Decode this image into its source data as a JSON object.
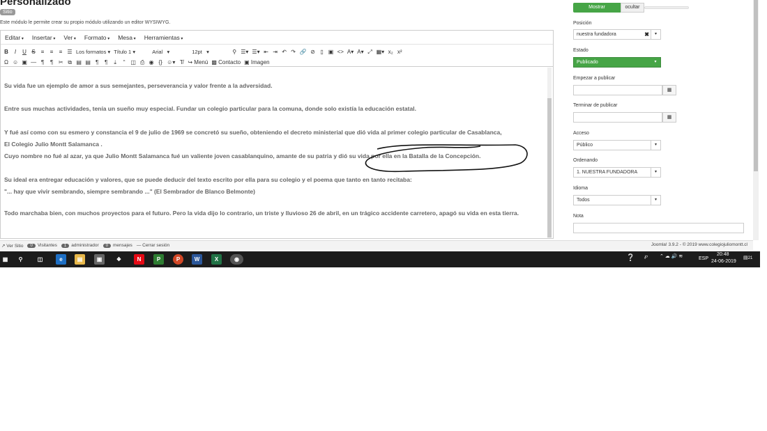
{
  "header": {
    "title": "Personalizado",
    "badge": "Sitio",
    "description": "Este módulo le permite crear su propio módulo utilizando un editor WYSIWYG."
  },
  "editor": {
    "menu": [
      "Editar",
      "Insertar",
      "Ver",
      "Formato",
      "Mesa",
      "Herramientas"
    ],
    "toolbar": {
      "formats_label": "Los formatos",
      "heading_value": "Título 1",
      "font_value": "Arial",
      "size_value": "12pt",
      "menu_button": "Menú",
      "contact_button": "Contacto",
      "image_button": "Imagen"
    },
    "paragraphs": [
      "Su vida fue un ejemplo de amor a sus semejantes, perseverancia y valor frente a la adversidad.",
      "Entre sus muchas actividades, tenía un sueño muy especial. Fundar  un colegio particular para la comuna, donde solo existía la educación estatal.",
      "Y fué así como con su esmero y constancia el  9 de julio de 1969 se concretó su sueño, obteniendo el decreto ministerial que dió vida al primer colegio particular de Casablanca,",
      "El Colegio Julio Montt Salamanca .",
      "Cuyo nombre no fué al azar, ya que  Julio Montt Salamanca  fué un valiente joven casablanquino, amante de su patria y dió su vida por ella  en la Batalla de la Concepción.",
      "Su ideal era entregar educación y valores, que se puede deducir del texto escrito por ella para su colegio y el poema que tanto en tanto recitaba:",
      "\"... hay que vivir sembrando, siempre sembrando ...\" (El Sembrador de Blanco Belmonte)",
      "Todo marchaba bien, con muchos proyectos para el futuro. Pero la vida dijo lo contrario, un triste y lluvioso  26 de abril, en un trágico accidente carretero, apagó su vida en esta tierra."
    ]
  },
  "statusbar": {
    "ver_sitio": "Ver Sitio",
    "visitors_count": "0",
    "visitors_label": "Visitantes",
    "admin_count": "1",
    "admin_label": "administrador",
    "messages_count": "0",
    "messages_label": "mensajes",
    "logout": "Cerrar sesión",
    "footer": "Joomla! 3.9.2 - © 2019 www.colegiojuliomontt.cl"
  },
  "panel": {
    "show_label": "Mostrar",
    "hide_label": "ocultar",
    "position_label": "Posición",
    "position_value": "nuestra fundadora",
    "estado_label": "Estado",
    "estado_value": "Publicado",
    "start_label": "Empezar a publicar",
    "end_label": "Terminar de publicar",
    "acceso_label": "Acceso",
    "acceso_value": "Público",
    "ordenando_label": "Ordenando",
    "ordenando_value": "1. NUESTRA FUNDADORA",
    "idioma_label": "Idioma",
    "idioma_value": "Todos",
    "nota_label": "Nota"
  },
  "taskbar": {
    "lang": "ESP",
    "time": "20:48",
    "date": "24-06-2019",
    "notifications": "21"
  },
  "colors": {
    "green": "#46a546",
    "taskbar": "#1c1c1c"
  }
}
